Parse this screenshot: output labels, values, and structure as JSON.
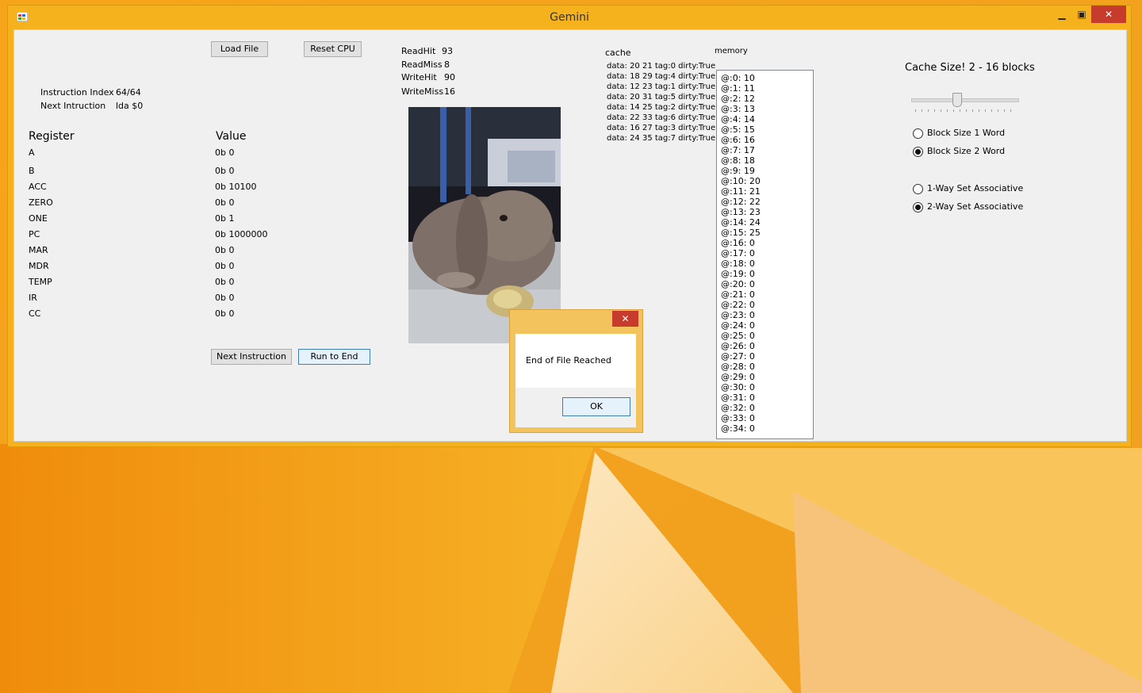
{
  "window": {
    "title": "Gemini",
    "minimize": "🗕",
    "maximize": "🗖",
    "close": "✕"
  },
  "buttons": {
    "load_file": "Load File",
    "reset_cpu": "Reset CPU",
    "next_instruction": "Next Instruction",
    "run_to_end": "Run to End"
  },
  "info": {
    "instruction_index_label": "Instruction Index",
    "instruction_index_value": "64/64",
    "next_instruction_label": "Next Intruction",
    "next_instruction_value": "lda $0"
  },
  "registers": {
    "header_register": "Register",
    "header_value": "Value",
    "rows": [
      {
        "name": "A",
        "value": "0b 0"
      },
      {
        "name": "B",
        "value": "0b 0"
      },
      {
        "name": "ACC",
        "value": "0b 10100"
      },
      {
        "name": "ZERO",
        "value": "0b 0"
      },
      {
        "name": "ONE",
        "value": "0b 1"
      },
      {
        "name": "PC",
        "value": "0b 1000000"
      },
      {
        "name": "MAR",
        "value": "0b 0"
      },
      {
        "name": "MDR",
        "value": "0b 0"
      },
      {
        "name": "TEMP",
        "value": "0b 0"
      },
      {
        "name": "IR",
        "value": "0b 0"
      },
      {
        "name": "CC",
        "value": "0b 0"
      }
    ]
  },
  "stats": [
    {
      "label": "ReadHit",
      "value": "93"
    },
    {
      "label": "ReadMiss",
      "value": "8"
    },
    {
      "label": "WriteHit",
      "value": "90"
    },
    {
      "label": "WriteMiss",
      "value": "16"
    }
  ],
  "cache": {
    "label": "cache",
    "lines": [
      "data: 20 21 tag:0 dirty:True",
      "data: 18 29 tag:4 dirty:True",
      "data: 12 23 tag:1 dirty:True",
      "data: 20 31 tag:5 dirty:True",
      "data: 14 25 tag:2 dirty:True",
      "data: 22 33 tag:6 dirty:True",
      "data: 16 27 tag:3 dirty:True",
      "data: 24 35 tag:7 dirty:True"
    ]
  },
  "memory": {
    "label": "memory",
    "lines": [
      "@:0: 10",
      "@:1: 11",
      "@:2: 12",
      "@:3: 13",
      "@:4: 14",
      "@:5: 15",
      "@:6: 16",
      "@:7: 17",
      "@:8: 18",
      "@:9: 19",
      "@:10: 20",
      "@:11: 21",
      "@:12: 22",
      "@:13: 23",
      "@:14: 24",
      "@:15: 25",
      "@:16: 0",
      "@:17: 0",
      "@:18: 0",
      "@:19: 0",
      "@:20: 0",
      "@:21: 0",
      "@:22: 0",
      "@:23: 0",
      "@:24: 0",
      "@:25: 0",
      "@:26: 0",
      "@:27: 0",
      "@:28: 0",
      "@:29: 0",
      "@:30: 0",
      "@:31: 0",
      "@:32: 0",
      "@:33: 0",
      "@:34: 0"
    ]
  },
  "cache_settings": {
    "size_label": "Cache Size!  2 - 16 blocks",
    "block_size_options": [
      {
        "label": "Block Size 1 Word",
        "selected": false
      },
      {
        "label": "Block Size 2 Word",
        "selected": true
      }
    ],
    "associativity_options": [
      {
        "label": "1-Way Set Associative",
        "selected": false
      },
      {
        "label": "2-Way Set Associative",
        "selected": true
      }
    ]
  },
  "dialog": {
    "message": "End of File Reached",
    "ok": "OK",
    "close": "✕"
  }
}
